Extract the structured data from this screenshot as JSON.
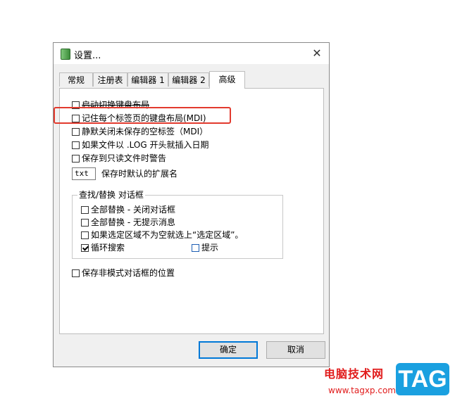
{
  "dialog": {
    "title": "设置...",
    "close_glyph": "✕"
  },
  "tabs": [
    {
      "label": "常规",
      "active": false
    },
    {
      "label": "注册表",
      "active": false
    },
    {
      "label": "编辑器 1",
      "active": false
    },
    {
      "label": "编辑器 2",
      "active": false
    },
    {
      "label": "高级",
      "active": true
    }
  ],
  "options": [
    {
      "label": "启动切换键盘布局",
      "checked": false
    },
    {
      "label": "记住每个标签页的键盘布局(MDI)",
      "checked": false
    },
    {
      "label": "静默关闭未保存的空标签（MDI）",
      "checked": false
    },
    {
      "label": "如果文件以 .LOG 开头就插入日期",
      "checked": false
    },
    {
      "label": "保存到只读文件时警告",
      "checked": false
    }
  ],
  "extension": {
    "value": "txt",
    "label": "保存时默认的扩展名"
  },
  "find_replace": {
    "title": "查找/替换 对话框",
    "items": [
      {
        "label": "全部替换 - 关闭对话框",
        "checked": false
      },
      {
        "label": "全部替换 - 无提示消息",
        "checked": false
      },
      {
        "label": "如果选定区域不为空就选上“选定区域”。",
        "checked": false
      },
      {
        "label": "循环搜索",
        "checked": true
      },
      {
        "label": "提示",
        "checked": false
      }
    ]
  },
  "save_position": {
    "label": "保存非模式对话框的位置",
    "checked": false
  },
  "buttons": {
    "ok": "确定",
    "cancel": "取消"
  },
  "watermark": {
    "text": "电脑技术网",
    "url": "www.tagxp.com",
    "tag": "TAG"
  },
  "colors": {
    "highlight": "#e23a2e",
    "accent": "#0078d7",
    "watermark_red": "#e11c1c",
    "watermark_blue": "#1aa0e0"
  }
}
